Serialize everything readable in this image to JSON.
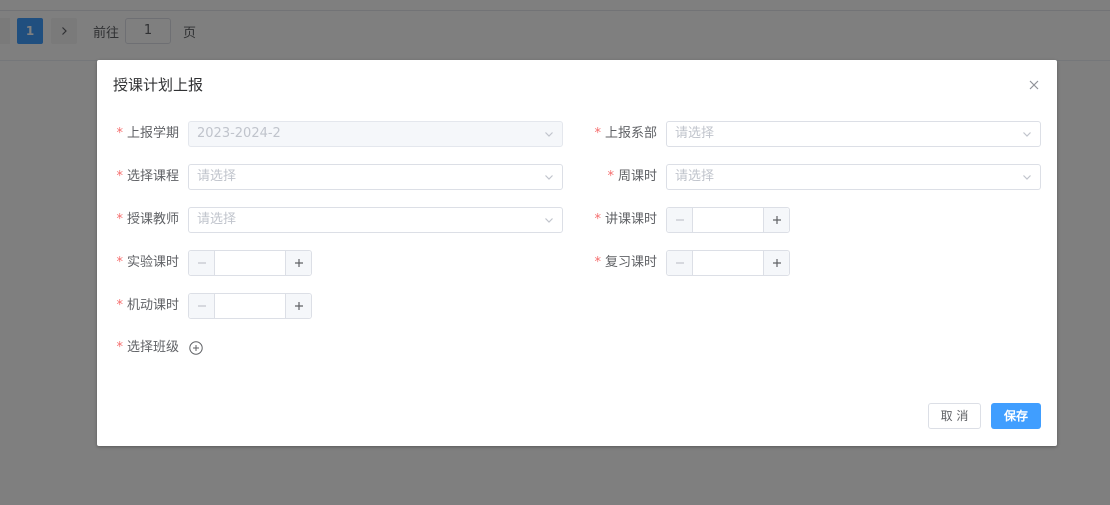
{
  "background": {
    "pagination": {
      "current_page": "1",
      "goto_label": "前往",
      "goto_value": "1",
      "page_suffix": "页"
    }
  },
  "dialog": {
    "title": "授课计划上报",
    "fields": {
      "semester": {
        "label": "上报学期",
        "value": "2023-2024-2"
      },
      "department": {
        "label": "上报系部",
        "placeholder": "请选择"
      },
      "course": {
        "label": "选择课程",
        "placeholder": "请选择"
      },
      "weekly_hours": {
        "label": "周课时",
        "placeholder": "请选择"
      },
      "teacher": {
        "label": "授课教师",
        "placeholder": "请选择"
      },
      "lecture_hours": {
        "label": "讲课课时",
        "value": ""
      },
      "lab_hours": {
        "label": "实验课时",
        "value": ""
      },
      "review_hours": {
        "label": "复习课时",
        "value": ""
      },
      "flexible_hours": {
        "label": "机动课时",
        "value": ""
      },
      "classes": {
        "label": "选择班级"
      }
    },
    "required_mark": "*",
    "buttons": {
      "cancel": "取 消",
      "save": "保存"
    }
  },
  "colors": {
    "primary": "#409eff",
    "required": "#f56c6c",
    "overlay": "rgba(0,0,0,0.5)"
  },
  "icons": {
    "close": "close-icon",
    "dropdown": "chevron-down-icon",
    "minus": "minus-icon",
    "plus": "plus-icon",
    "add": "plus-circle-icon",
    "next": "chevron-right-icon"
  }
}
